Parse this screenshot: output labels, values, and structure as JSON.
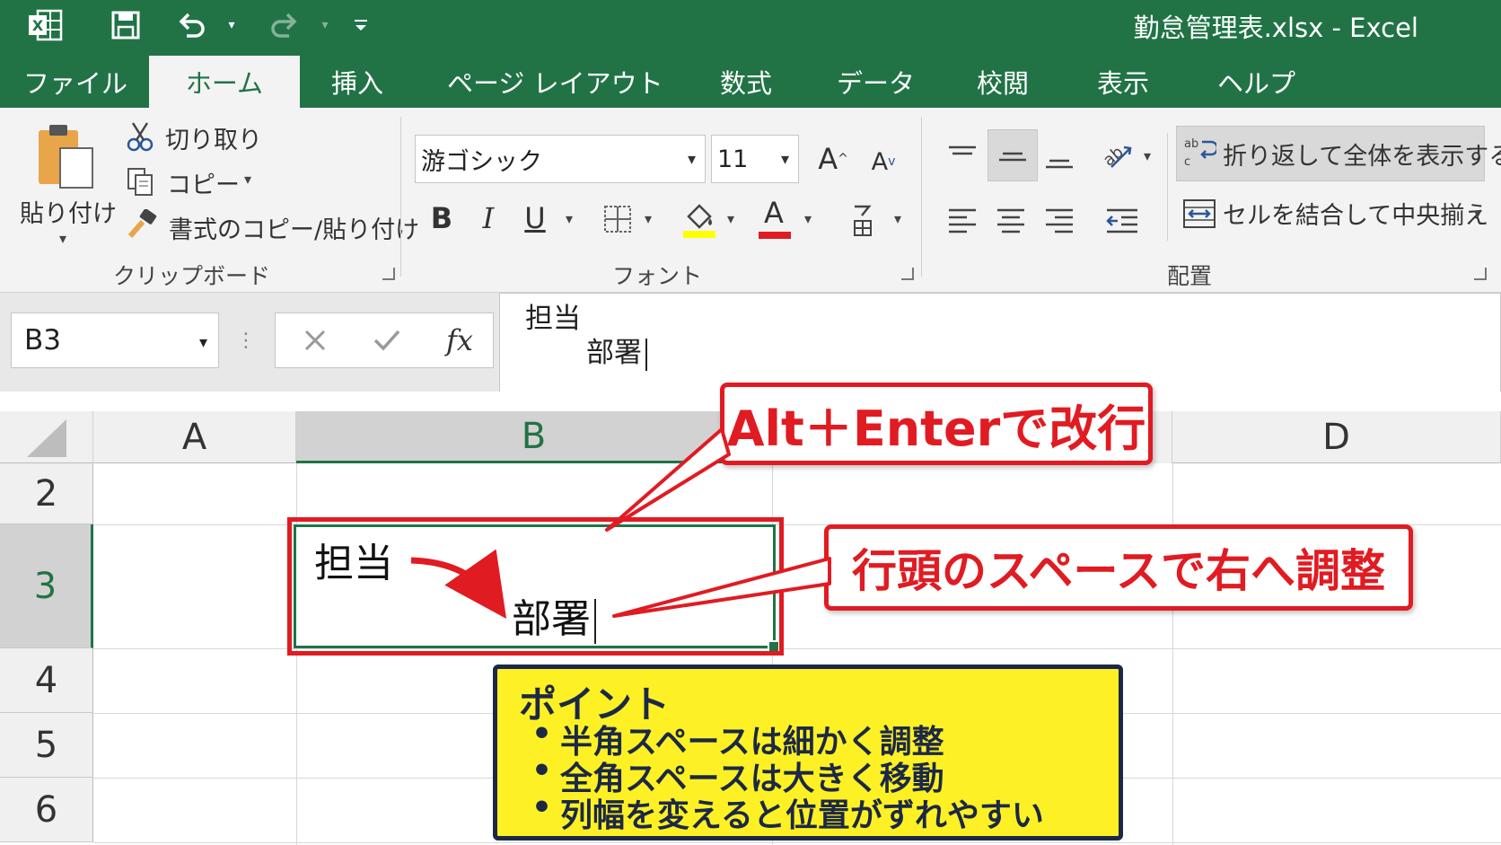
{
  "window": {
    "title": "勤怠管理表.xlsx  -  Excel",
    "excel_icon_label": "X",
    "accent_color": "#217346"
  },
  "tabs": [
    {
      "label": "ファイル"
    },
    {
      "label": "ホーム",
      "active": true
    },
    {
      "label": "挿入"
    },
    {
      "label": "ページ レイアウト"
    },
    {
      "label": "数式"
    },
    {
      "label": "データ"
    },
    {
      "label": "校閲"
    },
    {
      "label": "表示"
    },
    {
      "label": "ヘルプ"
    }
  ],
  "ribbon": {
    "clipboard": {
      "paste_label": "貼り付け",
      "cut_label": "切り取り",
      "copy_label": "コピー",
      "format_painter_label": "書式のコピー/貼り付け",
      "group_label": "クリップボード"
    },
    "font": {
      "font_name": "游ゴシック",
      "font_size": "11",
      "bold_label": "B",
      "italic_label": "I",
      "underline_label": "U",
      "font_color_label": "A",
      "group_label": "フォント"
    },
    "alignment": {
      "wrap_text_label": "折り返して全体を表示する",
      "merge_center_label": "セルを結合して中央揃え",
      "group_label": "配置"
    }
  },
  "formula_bar": {
    "name_box": "B3",
    "fx_label": "fx",
    "line1": "担当",
    "line2": "部署"
  },
  "grid": {
    "columns": [
      "A",
      "B",
      "D"
    ],
    "selected_column": "B",
    "rows": [
      "2",
      "3",
      "4",
      "5",
      "6"
    ],
    "selected_row": "3",
    "active_cell": {
      "ref": "B3",
      "line1": "担当",
      "line2": "部署"
    }
  },
  "annotations": {
    "callout_top": "Alt＋Enterで改行",
    "callout_right": "行頭のスペースで右へ調整",
    "point_title": "ポイント",
    "point_items": [
      "半角スペースは細かく調整",
      "全角スペースは大きく移動",
      "列幅を変えると位置がずれやすい"
    ],
    "highlight_color": "#e11b22",
    "point_bg_color": "#fdf126"
  }
}
